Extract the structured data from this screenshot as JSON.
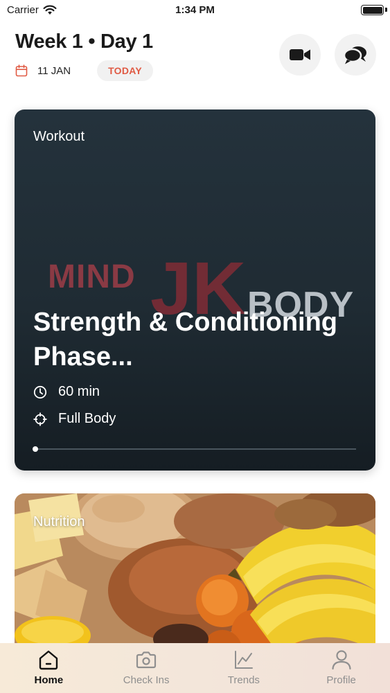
{
  "status_bar": {
    "carrier": "Carrier",
    "time": "1:34 PM"
  },
  "header": {
    "title": "Week 1 • Day 1",
    "date": "11 JAN",
    "today_badge": "TODAY",
    "icons": {
      "calendar": "calendar-icon",
      "video": "video-camera-icon",
      "chat": "chat-bubbles-icon"
    }
  },
  "workout": {
    "label": "Workout",
    "brand": {
      "left": "MIND",
      "initials": "JK",
      "right": "BODY"
    },
    "title": "Strength & Conditioning Phase...",
    "duration": "60 min",
    "focus": "Full Body",
    "progress": 0
  },
  "nutrition": {
    "label": "Nutrition"
  },
  "tabs": [
    {
      "label": "Home",
      "icon": "home-icon",
      "active": true
    },
    {
      "label": "Check Ins",
      "icon": "camera-icon",
      "active": false
    },
    {
      "label": "Trends",
      "icon": "chart-icon",
      "active": false
    },
    {
      "label": "Profile",
      "icon": "profile-icon",
      "active": false
    }
  ],
  "colors": {
    "accent": "#e05a44",
    "card_dark": "#1f2b33",
    "brand_red": "#8a3a44"
  }
}
